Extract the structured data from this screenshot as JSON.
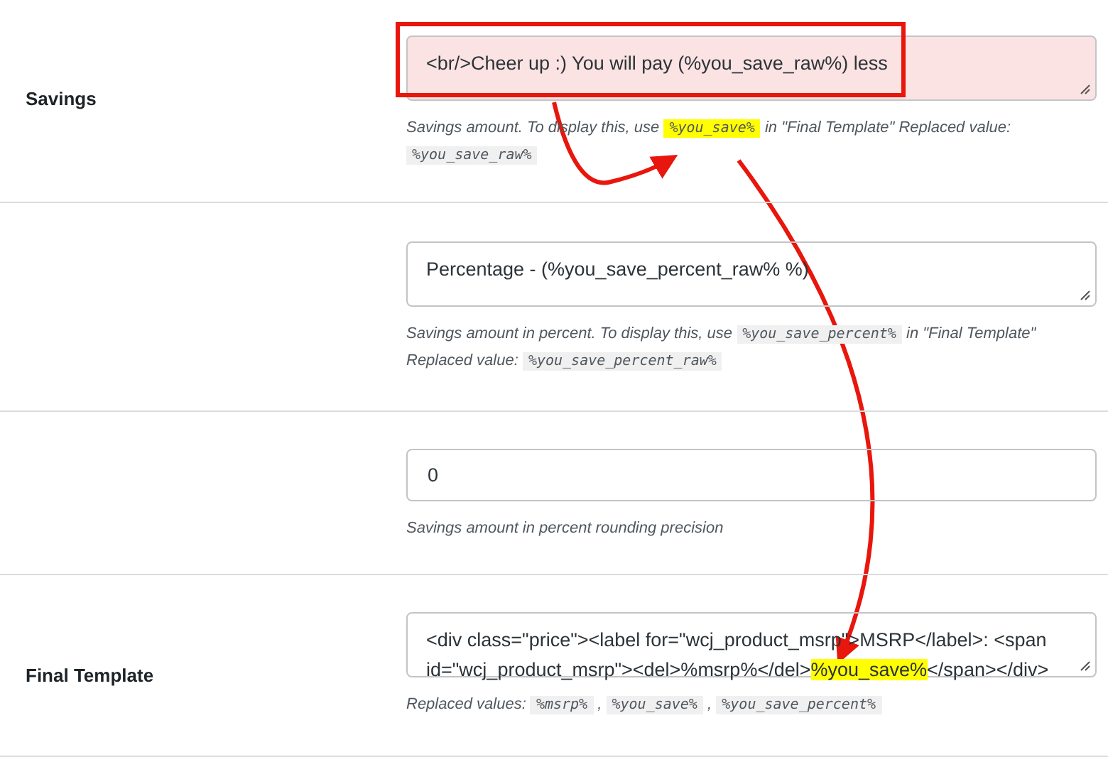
{
  "rows": [
    {
      "label": "Savings",
      "field": {
        "kind": "textarea",
        "segments": [
          {
            "text": "<br/>Cheer up :) You will pay (%you_save_raw%) less",
            "highlighted": false
          }
        ],
        "annotated": true
      },
      "description": [
        {
          "kind": "text",
          "text": "Savings amount. To display this, use "
        },
        {
          "kind": "code",
          "text": "%you_save%",
          "highlighted": true
        },
        {
          "kind": "text",
          "text": " in \"Final Template\" Replaced value: "
        },
        {
          "kind": "code",
          "text": "%you_save_raw%",
          "highlighted": false
        }
      ]
    },
    {
      "field": {
        "kind": "textarea",
        "segments": [
          {
            "text": "Percentage - (%you_save_percent_raw% %)",
            "highlighted": false
          }
        ],
        "annotated": false
      },
      "description": [
        {
          "kind": "text",
          "text": "Savings amount in percent. To display this, use "
        },
        {
          "kind": "code",
          "text": "%you_save_percent%",
          "highlighted": false
        },
        {
          "kind": "text",
          "text": " in \"Final Template\" Replaced value: "
        },
        {
          "kind": "code",
          "text": "%you_save_percent_raw%",
          "highlighted": false
        }
      ]
    },
    {
      "field": {
        "kind": "input",
        "segments": [
          {
            "text": "0",
            "highlighted": false
          }
        ],
        "annotated": false
      },
      "description": [
        {
          "kind": "text",
          "text": "Savings amount in percent rounding precision"
        }
      ]
    },
    {
      "label": "Final Template",
      "field": {
        "kind": "textarea",
        "segments": [
          {
            "text": "<div class=\"price\"><label for=\"wcj_product_msrp\">MSRP</label>: <span id=\"wcj_product_msrp\"><del>%msrp%</del>",
            "highlighted": false
          },
          {
            "text": "%you_save%",
            "highlighted": true
          },
          {
            "text": "</span></div>",
            "highlighted": false
          }
        ],
        "annotated": false
      },
      "description": [
        {
          "kind": "text",
          "text": "Replaced values: "
        },
        {
          "kind": "code",
          "text": "%msrp%",
          "highlighted": false
        },
        {
          "kind": "text",
          "text": " , "
        },
        {
          "kind": "code",
          "text": "%you_save%",
          "highlighted": false
        },
        {
          "kind": "text",
          "text": " , "
        },
        {
          "kind": "code",
          "text": "%you_save_percent%",
          "highlighted": false
        }
      ]
    }
  ],
  "annotations": [
    {
      "kind": "arrow"
    },
    {
      "kind": "arrow"
    }
  ]
}
